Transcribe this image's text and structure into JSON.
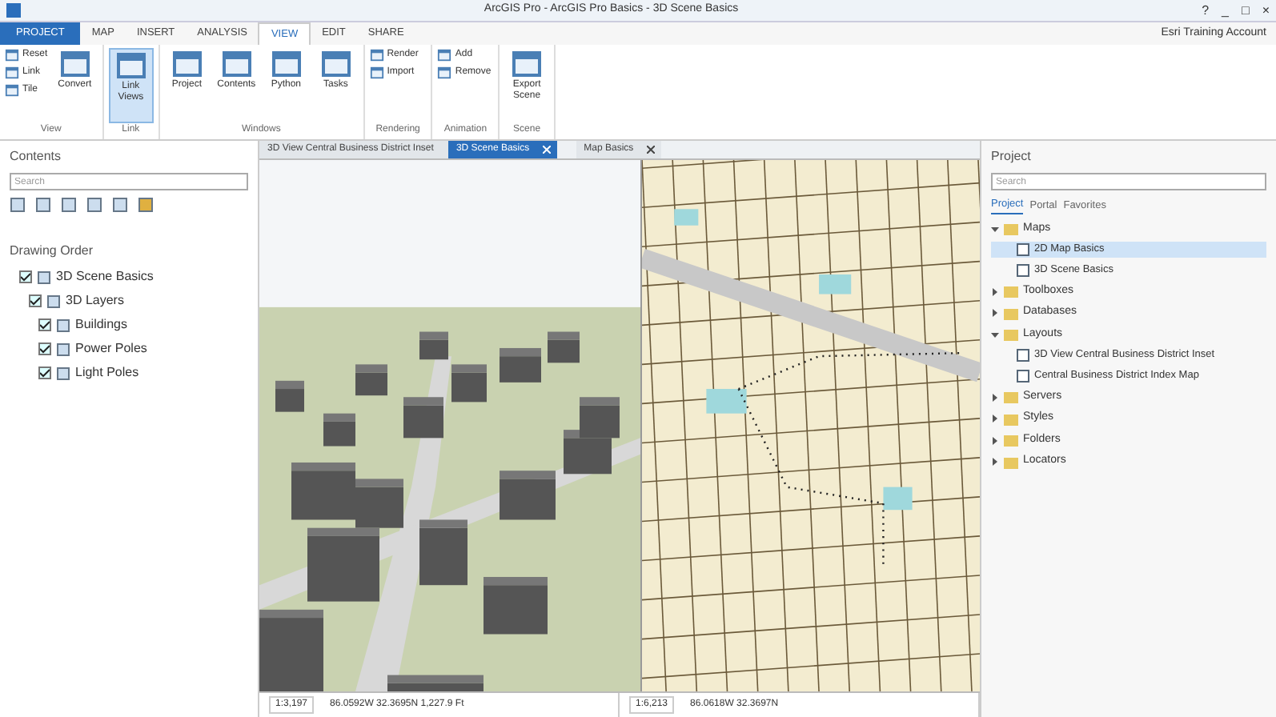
{
  "window": {
    "title": "ArcGIS Pro - ArcGIS Pro Basics - 3D Scene Basics",
    "controls": [
      "?",
      "_",
      "□",
      "×"
    ]
  },
  "ribbon_tabs": [
    {
      "label": "PROJECT",
      "kind": "file",
      "selected": false
    },
    {
      "label": "MAP",
      "kind": "tab",
      "selected": false
    },
    {
      "label": "INSERT",
      "kind": "tab",
      "selected": false
    },
    {
      "label": "ANALYSIS",
      "kind": "tab",
      "selected": false
    },
    {
      "label": "VIEW",
      "kind": "tab",
      "selected": true
    },
    {
      "label": "EDIT",
      "kind": "tab",
      "selected": false
    },
    {
      "label": "SHARE",
      "kind": "tab",
      "selected": false
    }
  ],
  "user": "Esri Training Account",
  "ribbon_groups": [
    {
      "label": "View",
      "buttons": [
        {
          "label": "Reset",
          "kind": "small"
        },
        {
          "label": "Link",
          "kind": "small"
        },
        {
          "label": "Tile",
          "kind": "small"
        },
        {
          "label": "Convert",
          "kind": "large"
        }
      ]
    },
    {
      "label": "Link",
      "buttons": [
        {
          "label": "Link Views",
          "kind": "large"
        }
      ]
    },
    {
      "label": "Windows",
      "buttons": [
        {
          "label": "Project",
          "kind": "large"
        },
        {
          "label": "Contents",
          "kind": "large"
        },
        {
          "label": "Python",
          "kind": "large"
        },
        {
          "label": "Tasks",
          "kind": "large"
        }
      ]
    },
    {
      "label": "Rendering",
      "buttons": [
        {
          "label": "Render",
          "kind": "small"
        },
        {
          "label": "Import",
          "kind": "small"
        }
      ]
    },
    {
      "label": "Animation",
      "buttons": [
        {
          "label": "Add",
          "kind": "small"
        },
        {
          "label": "Remove",
          "kind": "small"
        }
      ]
    },
    {
      "label": "Scene",
      "buttons": [
        {
          "label": "Export Scene",
          "kind": "large"
        }
      ]
    }
  ],
  "contents": {
    "title": "Contents",
    "search": {
      "placeholder": "Search"
    },
    "heading": "Drawing Order",
    "tree": [
      {
        "label": "3D Scene Basics",
        "checked": true,
        "children": [
          {
            "label": "3D Layers",
            "checked": true,
            "children": [
              {
                "label": "Buildings",
                "checked": true
              },
              {
                "label": "Power Poles",
                "checked": true
              },
              {
                "label": "Light Poles",
                "checked": true
              }
            ]
          }
        ]
      }
    ]
  },
  "view_tabs": [
    {
      "label": "3D View Central Business District Inset",
      "selected": false,
      "closable": false
    },
    {
      "label": "3D Scene Basics",
      "selected": true,
      "closable": true
    },
    {
      "label": "Map Basics",
      "selected": false,
      "closable": true
    }
  ],
  "status_bars": [
    {
      "scale": "1:3,197",
      "coords": "86.0592W 32.3695N  1,227.9 Ft"
    },
    {
      "scale": "1:6,213",
      "coords": "86.0618W 32.3697N"
    }
  ],
  "project": {
    "title": "Project",
    "search": {
      "placeholder": "Search"
    },
    "subtabs": [
      {
        "label": "Project",
        "selected": true
      },
      {
        "label": "Portal",
        "selected": false
      },
      {
        "label": "Favorites",
        "selected": false
      }
    ],
    "tree": [
      {
        "label": "Maps",
        "expanded": true,
        "children": [
          {
            "label": "2D Map Basics",
            "selected": true
          },
          {
            "label": "3D Scene Basics",
            "selected": false
          }
        ]
      },
      {
        "label": "Toolboxes",
        "expanded": false
      },
      {
        "label": "Databases",
        "expanded": false
      },
      {
        "label": "Layouts",
        "expanded": true,
        "children": [
          {
            "label": "3D View Central Business District Inset",
            "selected": false
          },
          {
            "label": "Central Business District Index Map",
            "selected": false
          }
        ]
      },
      {
        "label": "Servers",
        "expanded": false
      },
      {
        "label": "Styles",
        "expanded": false
      },
      {
        "label": "Folders",
        "expanded": false
      },
      {
        "label": "Locators",
        "expanded": false
      }
    ]
  }
}
